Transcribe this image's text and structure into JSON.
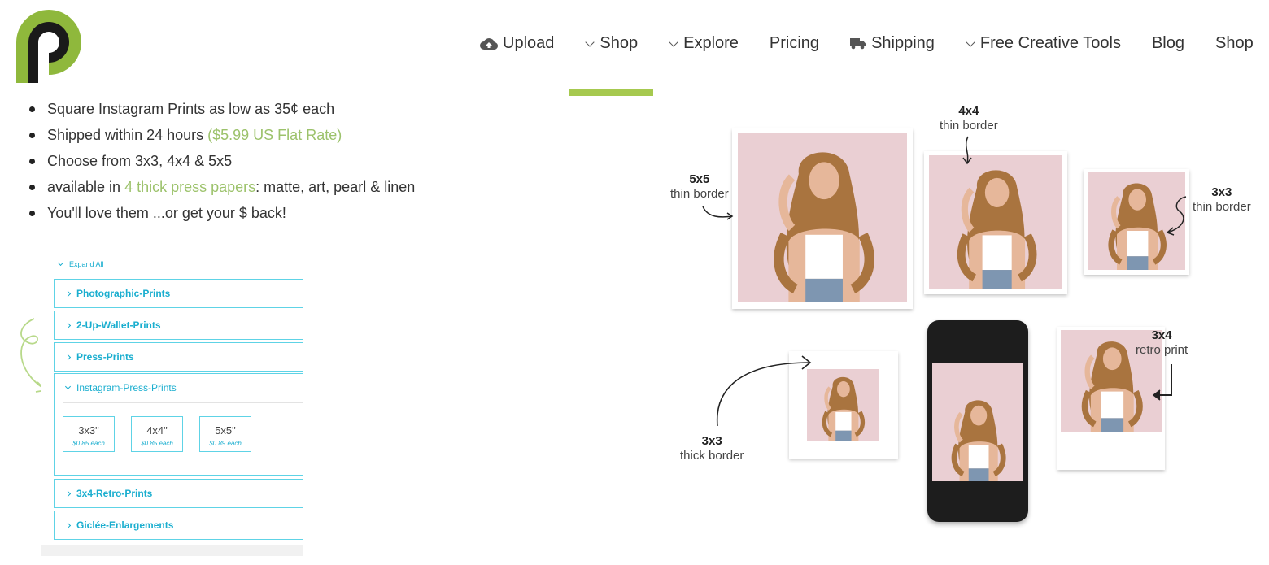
{
  "header": {
    "logo_icon": "p-logo-icon",
    "nav": [
      {
        "label": "Upload",
        "icon": "cloud-upload-icon"
      },
      {
        "label": "Shop",
        "icon": "chevron-down-icon"
      },
      {
        "label": "Explore",
        "icon": "chevron-down-icon"
      },
      {
        "label": "Pricing",
        "icon": ""
      },
      {
        "label": "Shipping",
        "icon": "truck-icon"
      },
      {
        "label": "Free Creative Tools",
        "icon": "chevron-down-icon"
      },
      {
        "label": "Blog",
        "icon": ""
      },
      {
        "label": "Shop",
        "icon": ""
      }
    ],
    "active_color": "#a6c94f"
  },
  "bullets": {
    "b1": "Square Instagram Prints as low as 35¢ each",
    "b2_text": "Shipped within 24 hours ",
    "b2_link": "($5.99 US Flat Rate)",
    "b3": "Choose from 3x3, 4x4 & 5x5",
    "b4_text": "available in ",
    "b4_link": "4 thick press papers",
    "b4_rest": ": matte, art, pearl & linen",
    "b5": "You'll love them ...or get your $ back!"
  },
  "accordion": {
    "expand_all": "Expand All",
    "rows": [
      "Photographic-Prints",
      "2-Up-Wallet-Prints",
      "Press-Prints",
      "3x4-Retro-Prints",
      "Giclée-Enlargements"
    ],
    "open_title": "Instagram-Press-Prints",
    "sizes": [
      {
        "size": "3x3\"",
        "price": "$0.85 each"
      },
      {
        "size": "4x4\"",
        "price": "$0.85 each"
      },
      {
        "size": "5x5\"",
        "price": "$0.89 each"
      }
    ],
    "accent": "#1aaecf"
  },
  "collage": {
    "l5x5": {
      "size": "5x5",
      "desc": "thin border"
    },
    "l4x4": {
      "size": "4x4",
      "desc": "thin border"
    },
    "l3x3a": {
      "size": "3x3",
      "desc": "thin border"
    },
    "l3x3b": {
      "size": "3x3",
      "desc": "thick border"
    },
    "l3x4": {
      "size": "3x4",
      "desc": "retro print"
    }
  }
}
